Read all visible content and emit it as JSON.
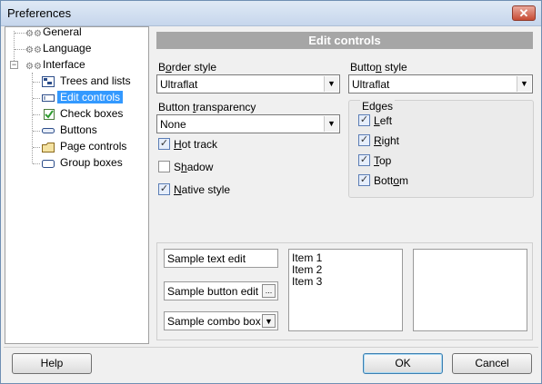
{
  "window": {
    "title": "Preferences"
  },
  "tree": {
    "items": [
      {
        "label": "General"
      },
      {
        "label": "Language"
      },
      {
        "label": "Interface"
      },
      {
        "label": "Trees and lists"
      },
      {
        "label": "Edit controls"
      },
      {
        "label": "Check boxes"
      },
      {
        "label": "Buttons"
      },
      {
        "label": "Page controls"
      },
      {
        "label": "Group boxes"
      }
    ],
    "selected": "Edit controls"
  },
  "panel": {
    "header": "Edit controls",
    "border_style": {
      "label_pre": "B",
      "label_u": "o",
      "label_post": "rder style",
      "value": "Ultraflat"
    },
    "button_style": {
      "label_pre": "Butto",
      "label_u": "n",
      "label_post": " style",
      "value": "Ultraflat"
    },
    "button_transparency": {
      "label_pre": "Button ",
      "label_u": "t",
      "label_post": "ransparency",
      "value": "None"
    },
    "checks": {
      "hot_track": {
        "u": "H",
        "rest": "ot track",
        "checked": true
      },
      "shadow": {
        "pre": "S",
        "u": "h",
        "rest": "adow",
        "checked": false
      },
      "native_style": {
        "u": "N",
        "rest": "ative style",
        "checked": true
      }
    },
    "edges": {
      "title": "Edges",
      "left": {
        "u": "L",
        "rest": "eft",
        "checked": true
      },
      "right": {
        "u": "R",
        "rest": "ight",
        "checked": true
      },
      "top": {
        "u": "T",
        "rest": "op",
        "checked": true
      },
      "bottom": {
        "pre": "Bott",
        "u": "o",
        "rest": "m",
        "checked": true
      }
    }
  },
  "samples": {
    "text_edit": "Sample text edit",
    "button_edit": "Sample button edit",
    "button_edit_glyph": "...",
    "combo_box": "Sample combo box",
    "list_items": [
      "Item 1",
      "Item 2",
      "Item 3"
    ]
  },
  "footer": {
    "help": "Help",
    "ok": "OK",
    "cancel": "Cancel"
  }
}
